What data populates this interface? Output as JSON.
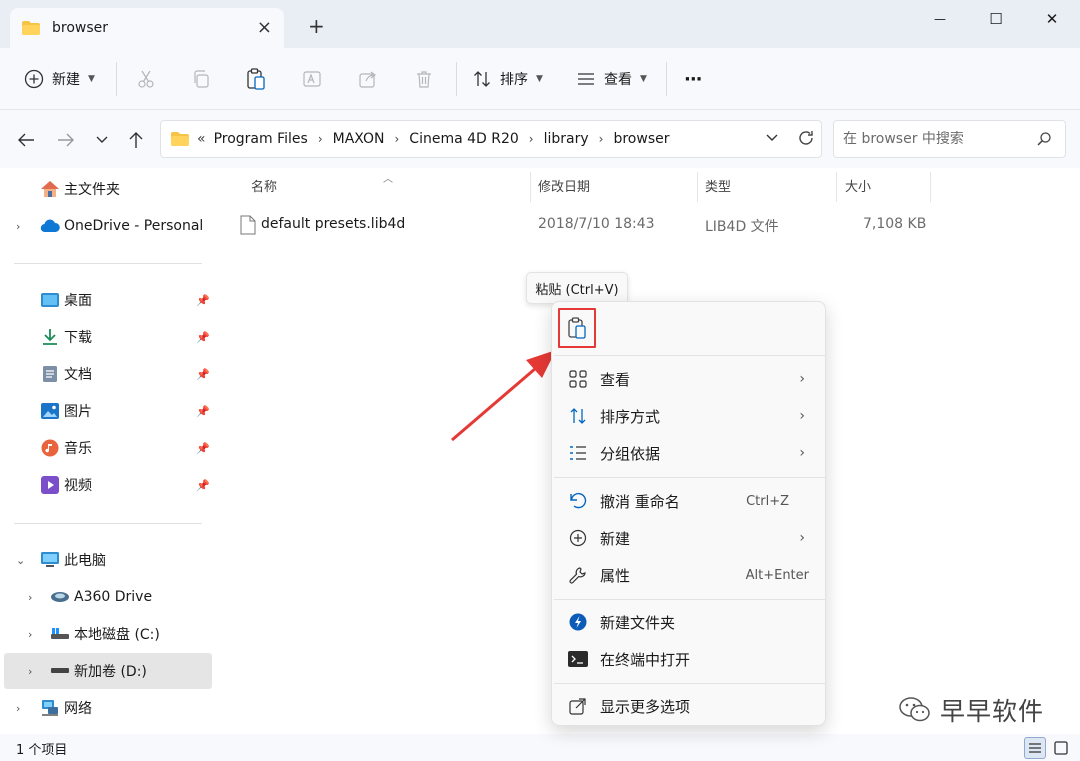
{
  "window": {
    "tab_title": "browser",
    "minimize_glyph": "—",
    "maximize_glyph": "☐",
    "close_glyph": "✕"
  },
  "toolbar": {
    "new_label": "新建",
    "sort_label": "排序",
    "view_label": "查看",
    "more_glyph": "···"
  },
  "address": {
    "breadcrumb": [
      "Program Files",
      "MAXON",
      "Cinema 4D R20",
      "library",
      "browser"
    ],
    "overflow_glyph": "«",
    "search_placeholder": "在 browser 中搜索"
  },
  "sidebar": {
    "home": "主文件夹",
    "onedrive": "OneDrive - Personal",
    "quick_access": [
      {
        "label": "桌面",
        "icon": "desktop-icon"
      },
      {
        "label": "下载",
        "icon": "download-icon"
      },
      {
        "label": "文档",
        "icon": "document-icon"
      },
      {
        "label": "图片",
        "icon": "pictures-icon"
      },
      {
        "label": "音乐",
        "icon": "music-icon"
      },
      {
        "label": "视频",
        "icon": "video-icon"
      }
    ],
    "this_pc": "此电脑",
    "drives": [
      {
        "label": "A360 Drive"
      },
      {
        "label": "本地磁盘 (C:)"
      },
      {
        "label": "新加卷 (D:)"
      }
    ],
    "network": "网络"
  },
  "file_list": {
    "columns": [
      "名称",
      "修改日期",
      "类型",
      "大小"
    ],
    "rows": [
      {
        "name": "default presets.lib4d",
        "modified": "2018/7/10 18:43",
        "type": "LIB4D 文件",
        "size": "7,108 KB"
      }
    ]
  },
  "status": {
    "item_count": "1 个项目"
  },
  "tooltip": {
    "text": "粘贴 (Ctrl+V)"
  },
  "context_menu": {
    "items": [
      {
        "label": "查看",
        "icon": "grid-icon",
        "submenu": "›"
      },
      {
        "label": "排序方式",
        "icon": "sort-icon",
        "submenu": "›"
      },
      {
        "label": "分组依据",
        "icon": "group-icon",
        "submenu": "›"
      },
      {
        "label": "撤消 重命名",
        "icon": "undo-icon",
        "shortcut": "Ctrl+Z"
      },
      {
        "label": "新建",
        "icon": "plus-circle-icon",
        "submenu": "›"
      },
      {
        "label": "属性",
        "icon": "wrench-icon",
        "shortcut": "Alt+Enter"
      },
      {
        "label": "新建文件夹",
        "icon": "new-folder-icon"
      },
      {
        "label": "在终端中打开",
        "icon": "terminal-icon"
      },
      {
        "label": "显示更多选项",
        "icon": "share-icon"
      }
    ]
  },
  "watermark": {
    "text": "早早软件"
  },
  "colors": {
    "accent": "#0067c0",
    "folder_yellow": "#f6c344",
    "highlight_red": "#e53935",
    "selection_grey": "#e5e5e5"
  }
}
